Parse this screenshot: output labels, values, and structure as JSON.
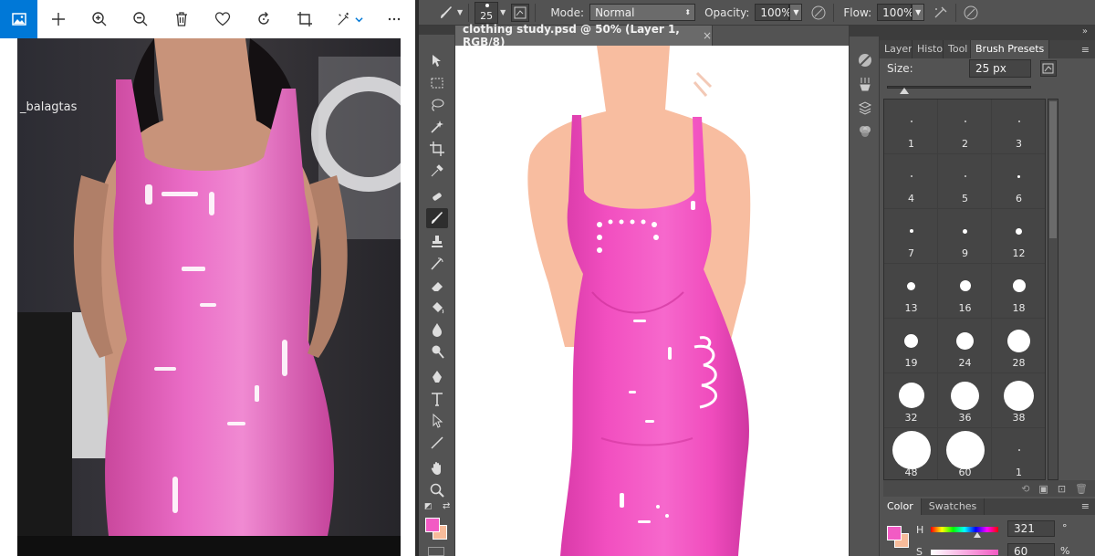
{
  "viewer": {
    "toolbar": {
      "app_icon": "photos-app-icon",
      "buttons": [
        "add-icon",
        "zoom-in-icon",
        "zoom-out-icon",
        "delete-icon",
        "favorite-icon",
        "rotate-icon",
        "crop-icon",
        "edit-icon",
        "more-icon"
      ]
    },
    "watermark": "_balagtas"
  },
  "photoshop": {
    "options": {
      "brush_size": "25",
      "mode_label": "Mode:",
      "mode_value": "Normal",
      "opacity_label": "Opacity:",
      "opacity_value": "100%",
      "flow_label": "Flow:",
      "flow_value": "100%"
    },
    "document_tab": {
      "title": "clothing study.psd @ 50% (Layer 1, RGB/8)",
      "close": "×"
    },
    "panel_tabs": [
      "Layer",
      "Histo",
      "Tool",
      "Brush Presets"
    ],
    "brush_presets": {
      "size_label": "Size:",
      "size_value": "25 px",
      "brushes": [
        {
          "label": "1",
          "diameter": 1
        },
        {
          "label": "2",
          "diameter": 1
        },
        {
          "label": "3",
          "diameter": 2
        },
        {
          "label": "4",
          "diameter": 2
        },
        {
          "label": "5",
          "diameter": 2
        },
        {
          "label": "6",
          "diameter": 3
        },
        {
          "label": "7",
          "diameter": 4
        },
        {
          "label": "9",
          "diameter": 5
        },
        {
          "label": "12",
          "diameter": 7
        },
        {
          "label": "13",
          "diameter": 9
        },
        {
          "label": "16",
          "diameter": 12
        },
        {
          "label": "18",
          "diameter": 14
        },
        {
          "label": "19",
          "diameter": 15
        },
        {
          "label": "24",
          "diameter": 19
        },
        {
          "label": "28",
          "diameter": 25
        },
        {
          "label": "32",
          "diameter": 28
        },
        {
          "label": "36",
          "diameter": 31
        },
        {
          "label": "38",
          "diameter": 33
        },
        {
          "label": "48",
          "diameter": 42
        },
        {
          "label": "60",
          "diameter": 42
        },
        {
          "label": "1",
          "diameter": 1
        }
      ]
    },
    "color_tabs": [
      "Color",
      "Swatches"
    ],
    "color": {
      "h_label": "H",
      "h_value": "321",
      "h_unit": "°",
      "s_label": "S",
      "s_value": "60",
      "s_unit": "%"
    },
    "colors": {
      "foreground": "#f25bc4",
      "background": "#f7bb9a",
      "dress_pink": "#f24fc0",
      "skin": "#f8bda0"
    }
  }
}
